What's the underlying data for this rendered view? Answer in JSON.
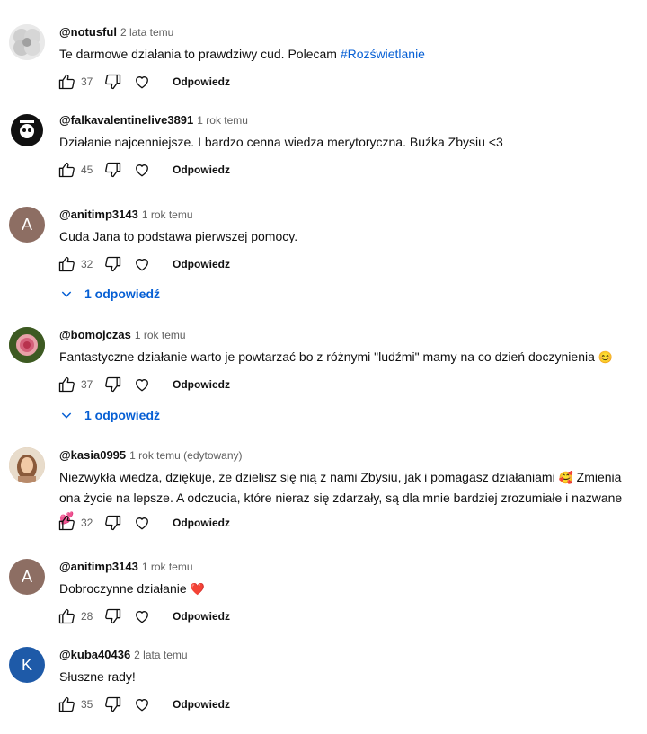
{
  "reply_label": "Odpowiedz",
  "comments": [
    {
      "author": "@notusful",
      "time": "2 lata temu",
      "text": "Te darmowe działania to prawdziwy cud. Polecam ",
      "hashtag": "#Rozświetlanie",
      "likes": "37",
      "avatar_letter": "",
      "avatar_color": "#d9d9d9"
    },
    {
      "author": "@falkavalentinelive3891",
      "time": "1 rok temu",
      "text": "Działanie najcenniejsze. I bardzo cenna wiedza merytoryczna. Buźka Zbysiu <3",
      "likes": "45",
      "avatar_letter": "",
      "avatar_color": "#111111"
    },
    {
      "author": "@anitimp3143",
      "time": "1 rok temu",
      "text": "Cuda Jana to podstawa pierwszej pomocy.",
      "likes": "32",
      "avatar_letter": "A",
      "avatar_color": "#8d6e63",
      "replies": "1 odpowiedź"
    },
    {
      "author": "@bomojczas",
      "time": "1 rok temu",
      "text": "Fantastyczne działanie warto je powtarzać bo z różnymi \"ludźmi\" mamy na co dzień doczynienia ",
      "emoji": "😊",
      "likes": "37",
      "avatar_letter": "",
      "avatar_color": "#4a6b2a",
      "replies": "1 odpowiedź"
    },
    {
      "author": "@kasia0995",
      "time": "1 rok temu (edytowany)",
      "text": "Niezwykła wiedza, dziękuje, że dzielisz się nią  z nami Zbysiu, jak i pomagasz działaniami ",
      "emoji": "🥰",
      "text2": " Zmienia ona życie na lepsze. A odczucia, które nieraz się zdarzały, są dla mnie bardziej zrozumiałe i nazwane ",
      "emoji2": "💕",
      "likes": "32",
      "avatar_letter": "",
      "avatar_color": "#c9a27a"
    },
    {
      "author": "@anitimp3143",
      "time": "1 rok temu",
      "text": "Dobroczynne działanie ",
      "emoji": "❤️",
      "likes": "28",
      "avatar_letter": "A",
      "avatar_color": "#8d6e63"
    },
    {
      "author": "@kuba40436",
      "time": "2 lata temu",
      "text": "Słuszne rady!",
      "likes": "35",
      "avatar_letter": "K",
      "avatar_color": "#1e5aa8"
    }
  ]
}
